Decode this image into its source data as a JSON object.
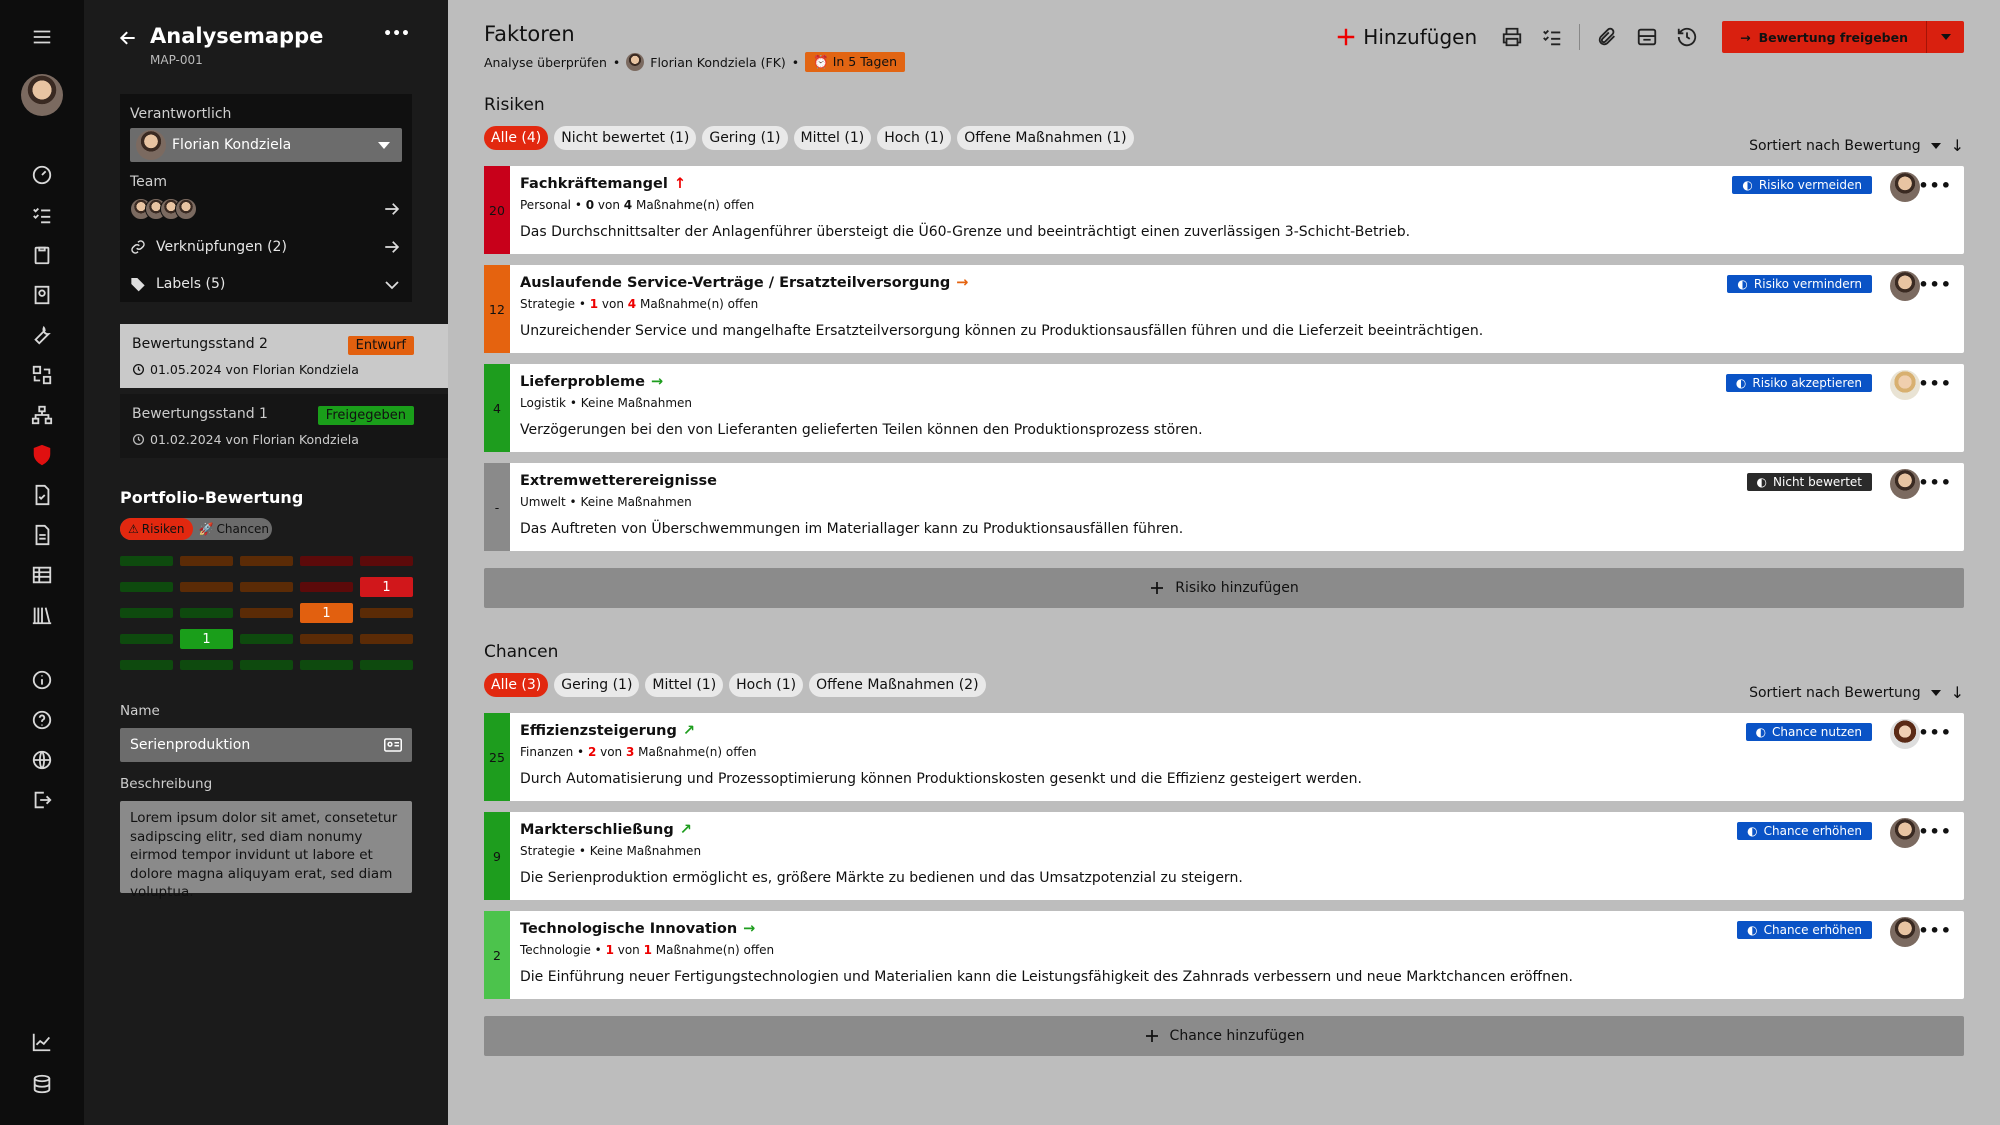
{
  "sidebar_left": {
    "nav_icons": [
      "menu-icon",
      "user-avatar",
      "dashboard-icon",
      "checklist-icon",
      "clipboard-icon",
      "award-icon",
      "wrench-icon",
      "transfer-icon",
      "org-chart-icon",
      "shield-icon",
      "document-check-icon",
      "document-icon",
      "table-icon",
      "library-icon",
      "info-icon",
      "help-icon",
      "globe-icon",
      "logout-icon",
      "chart-icon",
      "database-icon"
    ]
  },
  "panel": {
    "back_label": "←",
    "title": "Analysemappe",
    "id": "MAP-001",
    "more": "•••",
    "responsible_label": "Verantwortlich",
    "responsible_value": "Florian Kondziela",
    "team_label": "Team",
    "links_label": "Verknüpfungen (2)",
    "labels_label": "Labels (5)",
    "states": [
      {
        "title": "Bewertungsstand  2",
        "badge": "Entwurf",
        "date": "01.05.2024 von Florian Kondziela"
      },
      {
        "title": "Bewertungsstand  1",
        "badge": "Freigegeben",
        "date": "01.02.2024 von Florian Kondziela"
      }
    ],
    "portfolio_title": "Portfolio-Bewertung",
    "toggle_risks": "Risiken",
    "toggle_chances": "Chancen",
    "matrix_values": {
      "r2c5": "1",
      "r3c4": "1",
      "r4c2": "1"
    },
    "name_label": "Name",
    "name_value": "Serienproduktion",
    "desc_label": "Beschreibung",
    "desc_value": "Lorem ipsum dolor sit amet, consetetur sadipscing elitr, sed diam nonumy eirmod tempor invidunt ut labore et dolore magna aliquyam erat, sed diam voluptua."
  },
  "header": {
    "title": "Faktoren",
    "crumb_review": "Analyse überprüfen",
    "crumb_user": "Florian Kondziela (FK)",
    "due": "In 5 Tagen",
    "add_label": "Hinzufügen",
    "primary_label": "Bewertung freigeben"
  },
  "risks": {
    "title": "Risiken",
    "chips": [
      "Alle (4)",
      "Nicht bewertet (1)",
      "Gering (1)",
      "Mittel (1)",
      "Hoch (1)",
      "Offene Maßnahmen (1)"
    ],
    "sort_label": "Sortiert nach Bewertung",
    "add_label": "Risiko hinzufügen",
    "items": [
      {
        "score": "20",
        "color": "#c8001a",
        "title": "Fachkräftemangel",
        "trend": "↑",
        "trend_color": "#d00",
        "category": "Personal",
        "open_count": "0",
        "open_total": "4",
        "meta_suffix": "Maßnahme(n) offen",
        "description": "Das Durchschnittsalter der Anlagenführer übersteigt die Ü60-Grenze und beeinträchtigt einen zuverlässigen 3-Schicht-Betrieb.",
        "action": "Risiko vermeiden"
      },
      {
        "score": "12",
        "color": "#e5630f",
        "title": "Auslaufende Service-Verträge / Ersatzteilversorgung",
        "trend": "→",
        "trend_color": "#e5630f",
        "category": "Strategie",
        "open_count": "1",
        "open_total": "4",
        "meta_suffix": "Maßnahme(n) offen",
        "description": "Unzureichender Service und mangelhafte Ersatzteilversorgung können zu Produktionsausfällen führen und die Lieferzeit beeinträchtigen.",
        "action": "Risiko vermindern"
      },
      {
        "score": "4",
        "color": "#1e9d1e",
        "title": "Lieferprobleme",
        "trend": "→",
        "trend_color": "#1e9d1e",
        "category": "Logistik",
        "meta_text": "Keine Maßnahmen",
        "description": "Verzögerungen bei den von Lieferanten gelieferten Teilen können den Produktionsprozess stören.",
        "action": "Risiko akzeptieren"
      },
      {
        "score": "-",
        "color": "#8a8a8a",
        "title": "Extremwetterereignisse",
        "trend": "",
        "trend_color": "#000",
        "category": "Umwelt",
        "meta_text": "Keine Maßnahmen",
        "description": "Das Auftreten von Überschwemmungen im Materiallager kann zu Produktionsausfällen führen.",
        "action": "Nicht bewertet"
      }
    ]
  },
  "chances": {
    "title": "Chancen",
    "chips": [
      "Alle (3)",
      "Gering (1)",
      "Mittel (1)",
      "Hoch (1)",
      "Offene Maßnahmen (2)"
    ],
    "sort_label": "Sortiert nach Bewertung",
    "add_label": "Chance hinzufügen",
    "items": [
      {
        "score": "25",
        "color": "#1e9d1e",
        "title": "Effizienzsteigerung",
        "trend": "↗",
        "trend_color": "#1e9d1e",
        "category": "Finanzen",
        "open_count": "2",
        "open_total": "3",
        "meta_suffix": "Maßnahme(n) offen",
        "description": "Durch Automatisierung und Prozessoptimierung können Produktionskosten gesenkt und die Effizienz gesteigert werden.",
        "action": "Chance nutzen"
      },
      {
        "score": "9",
        "color": "#1e9d1e",
        "title": "Markterschließung",
        "trend": "↗",
        "trend_color": "#1e9d1e",
        "category": "Strategie",
        "meta_text": "Keine Maßnahmen",
        "description": "Die Serienproduktion ermöglicht es, größere Märkte zu bedienen und das Umsatzpotenzial zu steigern.",
        "action": "Chance erhöhen"
      },
      {
        "score": "2",
        "color": "#4cc34c",
        "title": "Technologische Innovation",
        "trend": "→",
        "trend_color": "#1e9d1e",
        "category": "Technologie",
        "open_count": "1",
        "open_total": "1",
        "meta_suffix": "Maßnahme(n) offen",
        "description": "Die Einführung neuer Fertigungstechnologien und Materialien kann die Leistungsfähigkeit des Zahnrads verbessern und neue Marktchancen eröffnen.",
        "action": "Chance erhöhen"
      }
    ]
  }
}
